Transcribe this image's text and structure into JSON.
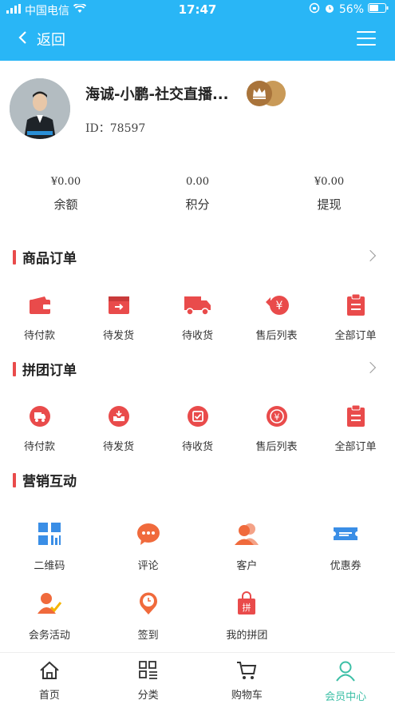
{
  "statusbar": {
    "carrier": "中国电信",
    "time": "17:47",
    "battery": "56%"
  },
  "nav": {
    "back_label": "返回"
  },
  "profile": {
    "name": "海诚-小鹏-社交直播...",
    "id_text": "ID：78597"
  },
  "stats": [
    {
      "value": "¥0.00",
      "label": "余额"
    },
    {
      "value": "0.00",
      "label": "积分"
    },
    {
      "value": "¥0.00",
      "label": "提现"
    }
  ],
  "goods_orders": {
    "title": "商品订单",
    "items": [
      {
        "label": "待付款",
        "icon": "wallet-icon"
      },
      {
        "label": "待发货",
        "icon": "box-icon"
      },
      {
        "label": "待收货",
        "icon": "truck-icon"
      },
      {
        "label": "售后列表",
        "icon": "yen-return-icon"
      },
      {
        "label": "全部订单",
        "icon": "clipboard-icon"
      }
    ]
  },
  "group_orders": {
    "title": "拼团订单",
    "items": [
      {
        "label": "待付款",
        "icon": "truck-circle-icon"
      },
      {
        "label": "待发货",
        "icon": "tray-circle-icon"
      },
      {
        "label": "待收货",
        "icon": "check-box-circle-icon"
      },
      {
        "label": "售后列表",
        "icon": "yen-circle-icon"
      },
      {
        "label": "全部订单",
        "icon": "clipboard-icon"
      }
    ]
  },
  "marketing": {
    "title": "营销互动",
    "items": [
      {
        "label": "二维码",
        "icon": "qrcode-icon"
      },
      {
        "label": "评论",
        "icon": "comment-icon"
      },
      {
        "label": "客户",
        "icon": "customer-icon"
      },
      {
        "label": "优惠券",
        "icon": "coupon-icon"
      },
      {
        "label": "会务活动",
        "icon": "event-icon"
      },
      {
        "label": "签到",
        "icon": "checkin-icon"
      },
      {
        "label": "我的拼团",
        "icon": "group-buy-icon"
      }
    ]
  },
  "tabbar": [
    {
      "label": "首页",
      "icon": "home-icon"
    },
    {
      "label": "分类",
      "icon": "category-icon"
    },
    {
      "label": "购物车",
      "icon": "cart-icon"
    },
    {
      "label": "会员中心",
      "icon": "member-icon",
      "active": true
    }
  ],
  "colors": {
    "header": "#29b6f6",
    "accent_red": "#e94b4b",
    "accent_orange": "#f06a3c",
    "accent_blue": "#3a8ee6",
    "active_tab": "#3cbfa6"
  }
}
